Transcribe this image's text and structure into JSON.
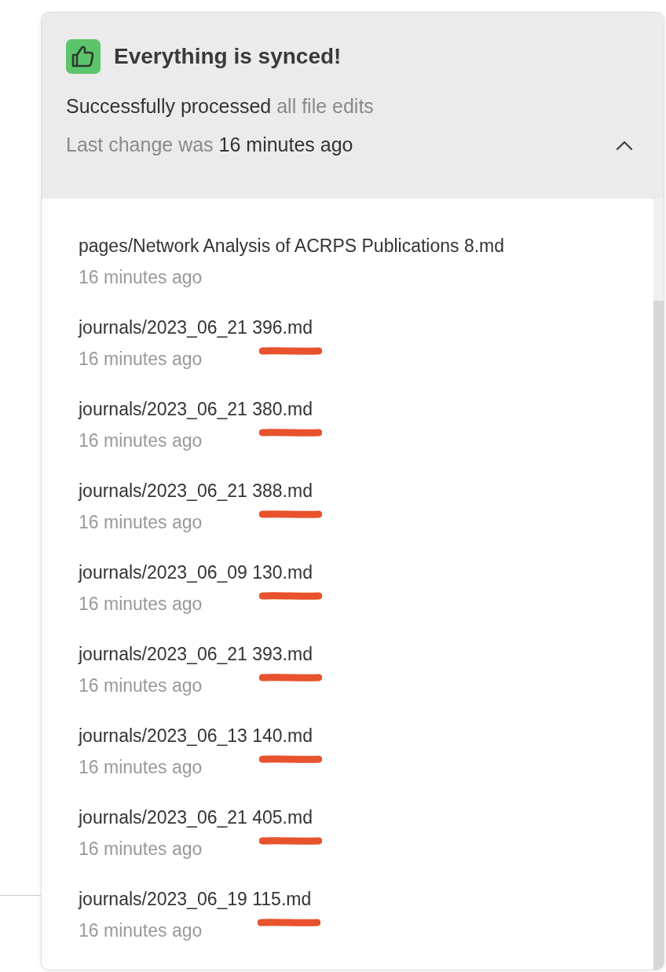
{
  "status": {
    "title": "Everything is synced!",
    "processed_label": "Successfully processed",
    "processed_value": "all file edits",
    "last_change_label": "Last change was",
    "last_change_value": "16 minutes ago",
    "expanded": true
  },
  "files": [
    {
      "name": "pages/Network Analysis of ACRPS Publications 8.md",
      "time": "16 minutes ago",
      "underlined": false
    },
    {
      "name": "journals/2023_06_21 396.md",
      "time": "16 minutes ago",
      "underlined": true
    },
    {
      "name": "journals/2023_06_21 380.md",
      "time": "16 minutes ago",
      "underlined": true
    },
    {
      "name": "journals/2023_06_21 388.md",
      "time": "16 minutes ago",
      "underlined": true
    },
    {
      "name": "journals/2023_06_09 130.md",
      "time": "16 minutes ago",
      "underlined": true
    },
    {
      "name": "journals/2023_06_21 393.md",
      "time": "16 minutes ago",
      "underlined": true
    },
    {
      "name": "journals/2023_06_13 140.md",
      "time": "16 minutes ago",
      "underlined": true
    },
    {
      "name": "journals/2023_06_21 405.md",
      "time": "16 minutes ago",
      "underlined": true
    },
    {
      "name": "journals/2023_06_19 115.md",
      "time": "16 minutes ago",
      "underlined": true
    }
  ]
}
